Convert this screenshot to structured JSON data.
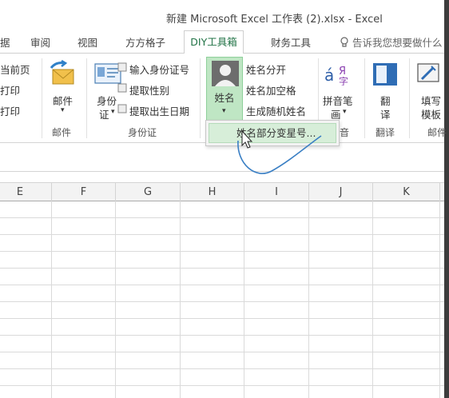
{
  "window": {
    "title": "新建 Microsoft Excel 工作表 (2).xlsx - Excel"
  },
  "tabs": [
    "据",
    "审阅",
    "视图",
    "方方格子",
    "DIY工具箱",
    "财务工具"
  ],
  "tell_me": "告诉我您想要做什么",
  "ribbon": {
    "page_group": {
      "items": [
        "当前页",
        "打印",
        "打印"
      ]
    },
    "mail_group": {
      "button": "邮件",
      "label": "邮件"
    },
    "id_group": {
      "button_line1": "身份",
      "button_line2": "证",
      "items": [
        "输入身份证号",
        "提取性别",
        "提取出生日期"
      ],
      "label": "身份证"
    },
    "name_group": {
      "button": "姓名",
      "items": [
        "姓名分开",
        "姓名加空格",
        "生成随机姓名"
      ],
      "label": "音"
    },
    "pinyin_group": {
      "button_line1": "拼音笔",
      "button_line2": "画"
    },
    "translate_group": {
      "button_line1": "翻",
      "button_line2": "译",
      "label": "翻译"
    },
    "template_group": {
      "button_line1": "填写",
      "button_line2": "模板",
      "label": "邮件"
    }
  },
  "dropdown": {
    "item": "姓名部分变星号..."
  },
  "columns": [
    "E",
    "F",
    "G",
    "H",
    "I",
    "J",
    "K"
  ],
  "colors": {
    "accent": "#217346",
    "selected_fill": "#bfe6c4",
    "annotation": "#3a7fc4"
  }
}
